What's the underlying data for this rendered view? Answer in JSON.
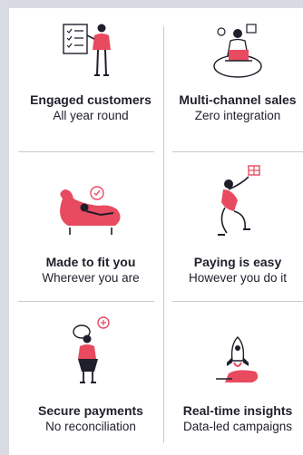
{
  "colors": {
    "accent": "#e84a5f",
    "ink": "#1f1f2b",
    "divider": "#c9c9cf",
    "background": "#d9dbe3"
  },
  "features": [
    {
      "title": "Engaged customers",
      "subtitle": "All year round",
      "icon": "presenter-board-icon"
    },
    {
      "title": "Multi-channel sales",
      "subtitle": "Zero integration",
      "icon": "laptop-person-icon"
    },
    {
      "title": "Made to fit you",
      "subtitle": "Wherever you are",
      "icon": "sofa-relax-icon"
    },
    {
      "title": "Paying is easy",
      "subtitle": "However you do it",
      "icon": "gift-jump-icon"
    },
    {
      "title": "Secure payments",
      "subtitle": "No reconciliation",
      "icon": "carry-bag-icon"
    },
    {
      "title": "Real-time insights",
      "subtitle": "Data-led campaigns",
      "icon": "rocket-launch-icon"
    }
  ]
}
